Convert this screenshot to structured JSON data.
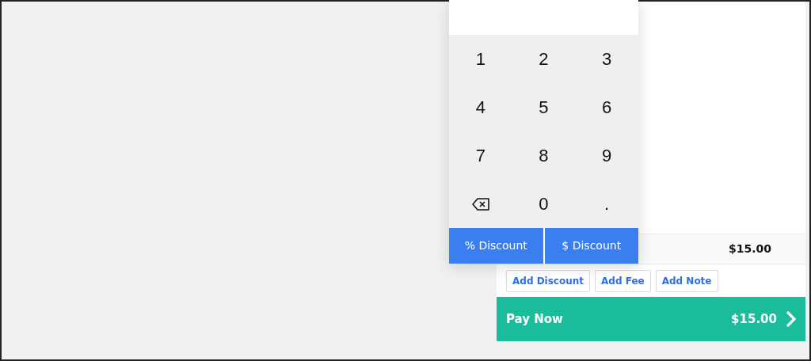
{
  "keypad": {
    "keys": [
      {
        "kind": "digit",
        "label": "1"
      },
      {
        "kind": "digit",
        "label": "2"
      },
      {
        "kind": "digit",
        "label": "3"
      },
      {
        "kind": "digit",
        "label": "4"
      },
      {
        "kind": "digit",
        "label": "5"
      },
      {
        "kind": "digit",
        "label": "6"
      },
      {
        "kind": "digit",
        "label": "7"
      },
      {
        "kind": "digit",
        "label": "8"
      },
      {
        "kind": "digit",
        "label": "9"
      },
      {
        "kind": "backspace"
      },
      {
        "kind": "digit",
        "label": "0"
      },
      {
        "kind": "digit",
        "label": "."
      }
    ],
    "discount_buttons": [
      "% Discount",
      "$ Discount"
    ]
  },
  "cart": {
    "total": "$15.00",
    "actions": [
      "Add Discount",
      "Add Fee",
      "Add Note"
    ],
    "pay_button": {
      "label": "Pay Now",
      "amount": "$15.00"
    }
  }
}
